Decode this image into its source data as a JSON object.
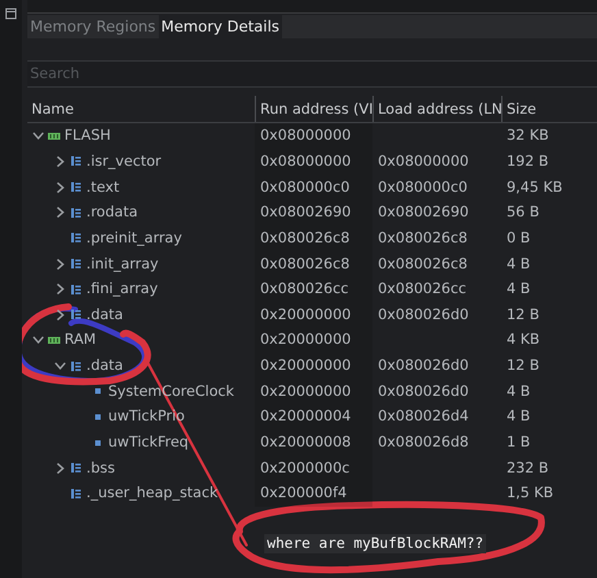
{
  "tabs": [
    {
      "label": "Memory Regions",
      "selected": false
    },
    {
      "label": "Memory Details",
      "selected": true
    }
  ],
  "search": {
    "placeholder": "Search"
  },
  "table": {
    "columns": [
      "Name",
      "Run address (VI",
      "Load address (LN",
      "Size"
    ],
    "rows": [
      {
        "kind": "region",
        "name": "FLASH",
        "expandable": true,
        "expanded": true,
        "run": "0x08000000",
        "size": "32 KB",
        "children": [
          {
            "kind": "section",
            "name": ".isr_vector",
            "expandable": true,
            "expanded": false,
            "run": "0x08000000",
            "load": "0x08000000",
            "size": "192 B"
          },
          {
            "kind": "section",
            "name": ".text",
            "expandable": true,
            "expanded": false,
            "run": "0x080000c0",
            "load": "0x080000c0",
            "size": "9,45 KB"
          },
          {
            "kind": "section",
            "name": ".rodata",
            "expandable": true,
            "expanded": false,
            "run": "0x08002690",
            "load": "0x08002690",
            "size": "56 B"
          },
          {
            "kind": "section",
            "name": ".preinit_array",
            "expandable": false,
            "run": "0x080026c8",
            "load": "0x080026c8",
            "size": "0 B"
          },
          {
            "kind": "section",
            "name": ".init_array",
            "expandable": true,
            "expanded": false,
            "run": "0x080026c8",
            "load": "0x080026c8",
            "size": "4 B"
          },
          {
            "kind": "section",
            "name": ".fini_array",
            "expandable": true,
            "expanded": false,
            "run": "0x080026cc",
            "load": "0x080026cc",
            "size": "4 B"
          },
          {
            "kind": "section",
            "name": ".data",
            "expandable": true,
            "expanded": false,
            "run": "0x20000000",
            "load": "0x080026d0",
            "size": "12 B"
          }
        ]
      },
      {
        "kind": "region",
        "name": "RAM",
        "expandable": true,
        "expanded": true,
        "run": "0x20000000",
        "size": "4 KB",
        "children": [
          {
            "kind": "section",
            "name": ".data",
            "expandable": true,
            "expanded": true,
            "run": "0x20000000",
            "load": "0x080026d0",
            "size": "12 B",
            "children": [
              {
                "kind": "symbol",
                "name": "SystemCoreClock",
                "expandable": false,
                "run": "0x20000000",
                "load": "0x080026d0",
                "size": "4 B"
              },
              {
                "kind": "symbol",
                "name": "uwTickPrio",
                "expandable": false,
                "run": "0x20000004",
                "load": "0x080026d4",
                "size": "4 B"
              },
              {
                "kind": "symbol",
                "name": "uwTickFreq",
                "expandable": false,
                "run": "0x20000008",
                "load": "0x080026d8",
                "size": "1 B"
              }
            ]
          },
          {
            "kind": "section",
            "name": ".bss",
            "expandable": true,
            "expanded": false,
            "run": "0x2000000c",
            "size": "232 B"
          },
          {
            "kind": "section",
            "name": "._user_heap_stack",
            "expandable": false,
            "run": "0x200000f4",
            "size": "1,5 KB"
          }
        ]
      }
    ]
  },
  "annotation": {
    "text": "where are myBufBlockRAM??"
  }
}
